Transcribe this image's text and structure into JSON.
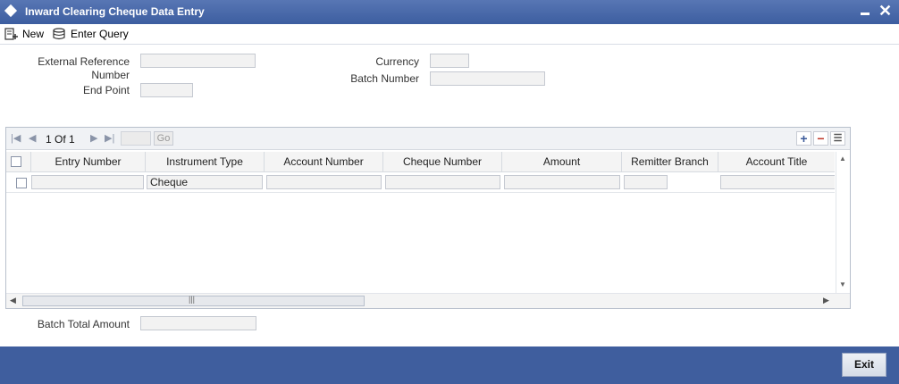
{
  "window": {
    "title": "Inward Clearing Cheque Data Entry"
  },
  "toolbar": {
    "new_label": "New",
    "enter_query_label": "Enter Query"
  },
  "form": {
    "external_reference_label_line1": "External Reference",
    "external_reference_label_line2": "Number",
    "external_reference_value": "",
    "end_point_label": "End Point",
    "end_point_value": "",
    "currency_label": "Currency",
    "currency_value": "",
    "batch_number_label": "Batch Number",
    "batch_number_value": "",
    "batch_total_label": "Batch Total Amount",
    "batch_total_value": ""
  },
  "grid": {
    "pager": {
      "text": "1 Of 1",
      "go_label": "Go",
      "page_input": ""
    },
    "columns": [
      "Entry Number",
      "Instrument Type",
      "Account Number",
      "Cheque Number",
      "Amount",
      "Remitter Branch",
      "Account Title"
    ],
    "rows": [
      {
        "entry_number": "",
        "instrument_type": "Cheque",
        "account_number": "",
        "cheque_number": "",
        "amount": "",
        "remitter_branch": "",
        "account_title": ""
      }
    ]
  },
  "footer": {
    "exit_label": "Exit"
  },
  "colors": {
    "titlebar": "#3d5ea0",
    "footer": "#3f5e9e",
    "add_icon": "#3b5a9a",
    "delete_icon": "#c0392b"
  }
}
